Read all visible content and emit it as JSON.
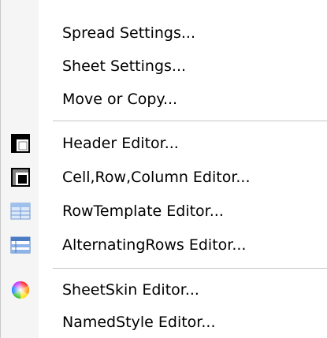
{
  "menu": {
    "items": [
      {
        "label": "Spread Settings..."
      },
      {
        "label": "Sheet Settings..."
      },
      {
        "label": "Move or Copy..."
      },
      {
        "label": "Header Editor...",
        "icon": "header-editor-icon"
      },
      {
        "label": "Cell,Row,Column Editor...",
        "icon": "cell-editor-icon"
      },
      {
        "label": "RowTemplate Editor...",
        "icon": "row-template-icon"
      },
      {
        "label": "AlternatingRows Editor...",
        "icon": "alternating-rows-icon"
      },
      {
        "label": "SheetSkin Editor...",
        "icon": "color-wheel-icon"
      },
      {
        "label": "NamedStyle Editor..."
      }
    ]
  }
}
